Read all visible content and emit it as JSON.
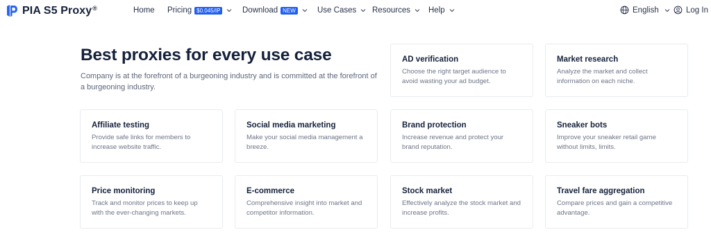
{
  "brand": {
    "name": "PIA S5 Proxy",
    "reg": "®"
  },
  "nav": {
    "home": "Home",
    "pricing": "Pricing",
    "pricing_badge": "$0.045/IP",
    "download": "Download",
    "download_badge": "NEW",
    "use_cases": "Use Cases",
    "resources": "Resources",
    "help": "Help",
    "language": "English",
    "login": "Log In"
  },
  "hero": {
    "title": "Best proxies for every use case",
    "description": "Company is at the forefront of a burgeoning industry and is committed at the forefront of a burgeoning industry."
  },
  "cards": [
    {
      "title": "AD verification",
      "description": "Choose the right target audience to avoid wasting your ad budget."
    },
    {
      "title": "Market research",
      "description": "Analyze the market and collect information on each niche."
    },
    {
      "title": "Affiliate testing",
      "description": "Provide safe links for members to increase website traffic."
    },
    {
      "title": "Social media marketing",
      "description": "Make your social media management a breeze."
    },
    {
      "title": "Brand protection",
      "description": "Increase revenue and protect your brand reputation."
    },
    {
      "title": "Sneaker bots",
      "description": "Improve your sneaker retail game without limits, limits."
    },
    {
      "title": "Price monitoring",
      "description": "Track and monitor prices to keep up with the ever-changing markets."
    },
    {
      "title": "E-commerce",
      "description": "Comprehensive insight into market and competitor information."
    },
    {
      "title": "Stock market",
      "description": "Effectively analyze the stock market and increase profits."
    },
    {
      "title": "Travel fare aggregation",
      "description": "Compare prices and gain a competitive advantage."
    }
  ],
  "colors": {
    "accent": "#1f5ef0",
    "logo_blue": "#2a66e8",
    "heading": "#14203a",
    "muted": "#6d7487",
    "border": "#e8ebf0"
  },
  "icons": {
    "logo": "pia-logo-icon",
    "chevron": "chevron-down-icon",
    "globe": "globe-icon",
    "user": "user-icon"
  }
}
